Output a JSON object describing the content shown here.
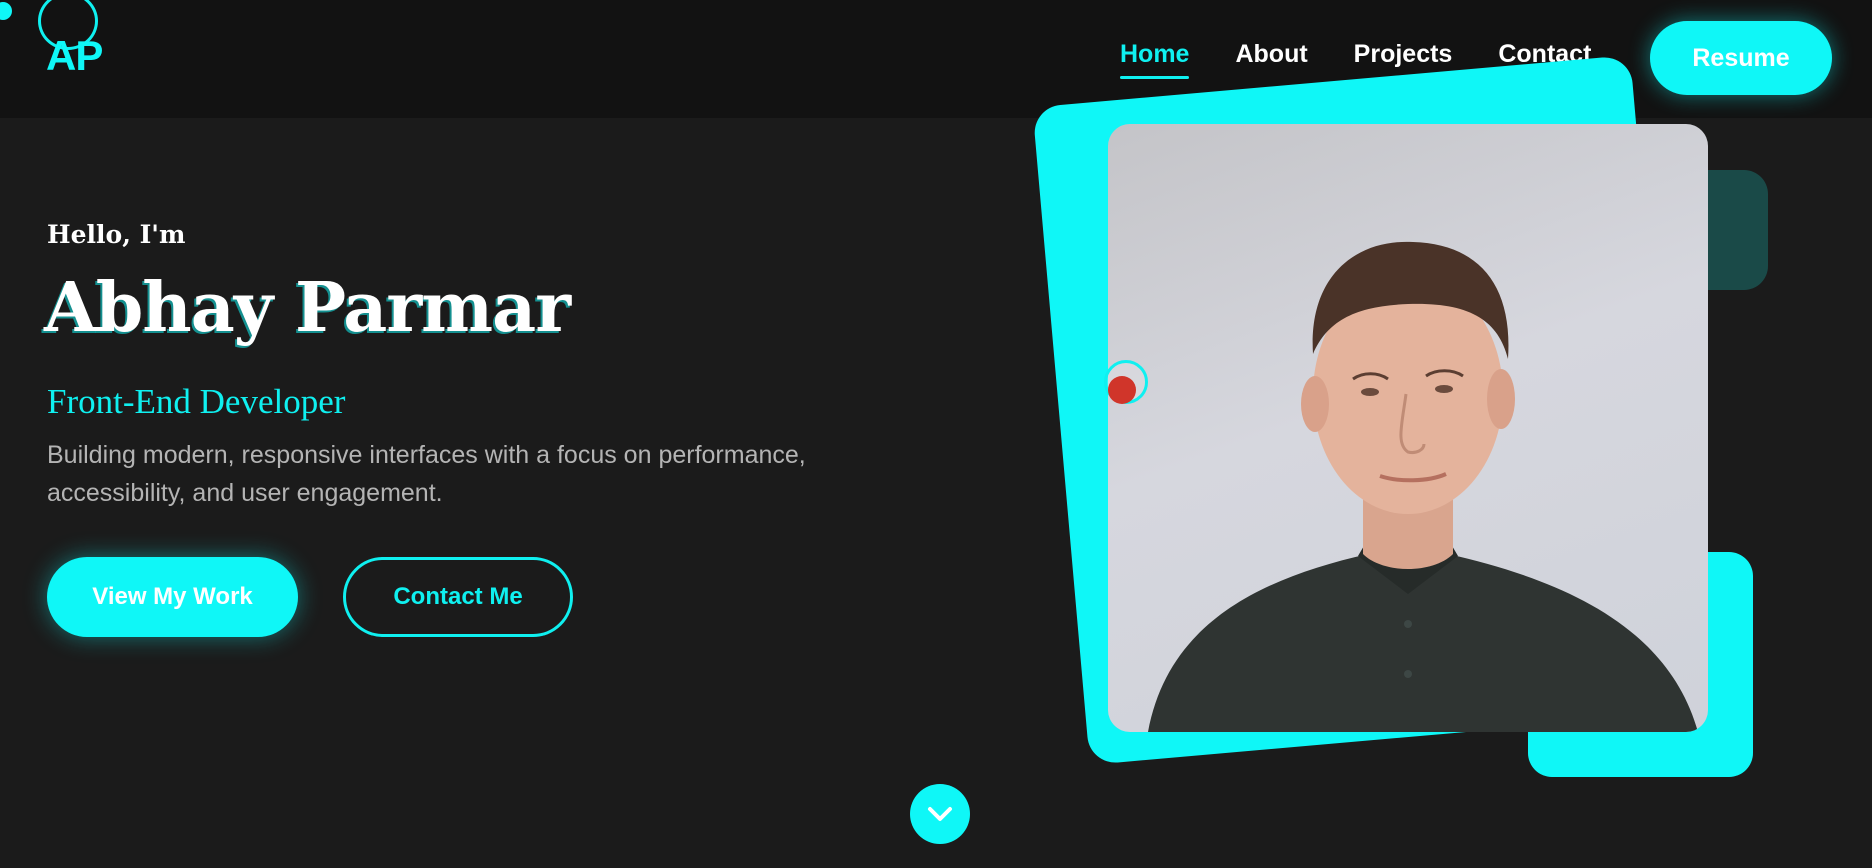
{
  "logo": {
    "text": "AP"
  },
  "nav": {
    "items": [
      {
        "label": "Home"
      },
      {
        "label": "About"
      },
      {
        "label": "Projects"
      },
      {
        "label": "Contact"
      }
    ],
    "active": "Home",
    "resume_label": "Resume"
  },
  "hero": {
    "greeting": "Hello, I'm",
    "name": "Abhay Parmar",
    "role": "Front-End Developer",
    "description": "Building modern, responsive interfaces with a focus on performance, accessibility, and user engagement.",
    "primary_button": "View My Work",
    "secondary_button": "Contact Me"
  },
  "icons": {
    "scroll": "chevron-down-icon",
    "recording": "record-icon"
  },
  "colors": {
    "accent": "#0ff7f7",
    "background": "#1b1b1b",
    "header": "#121212",
    "text": "#ffffff",
    "muted_text": "#b4b4b4",
    "record": "#d0352a"
  }
}
